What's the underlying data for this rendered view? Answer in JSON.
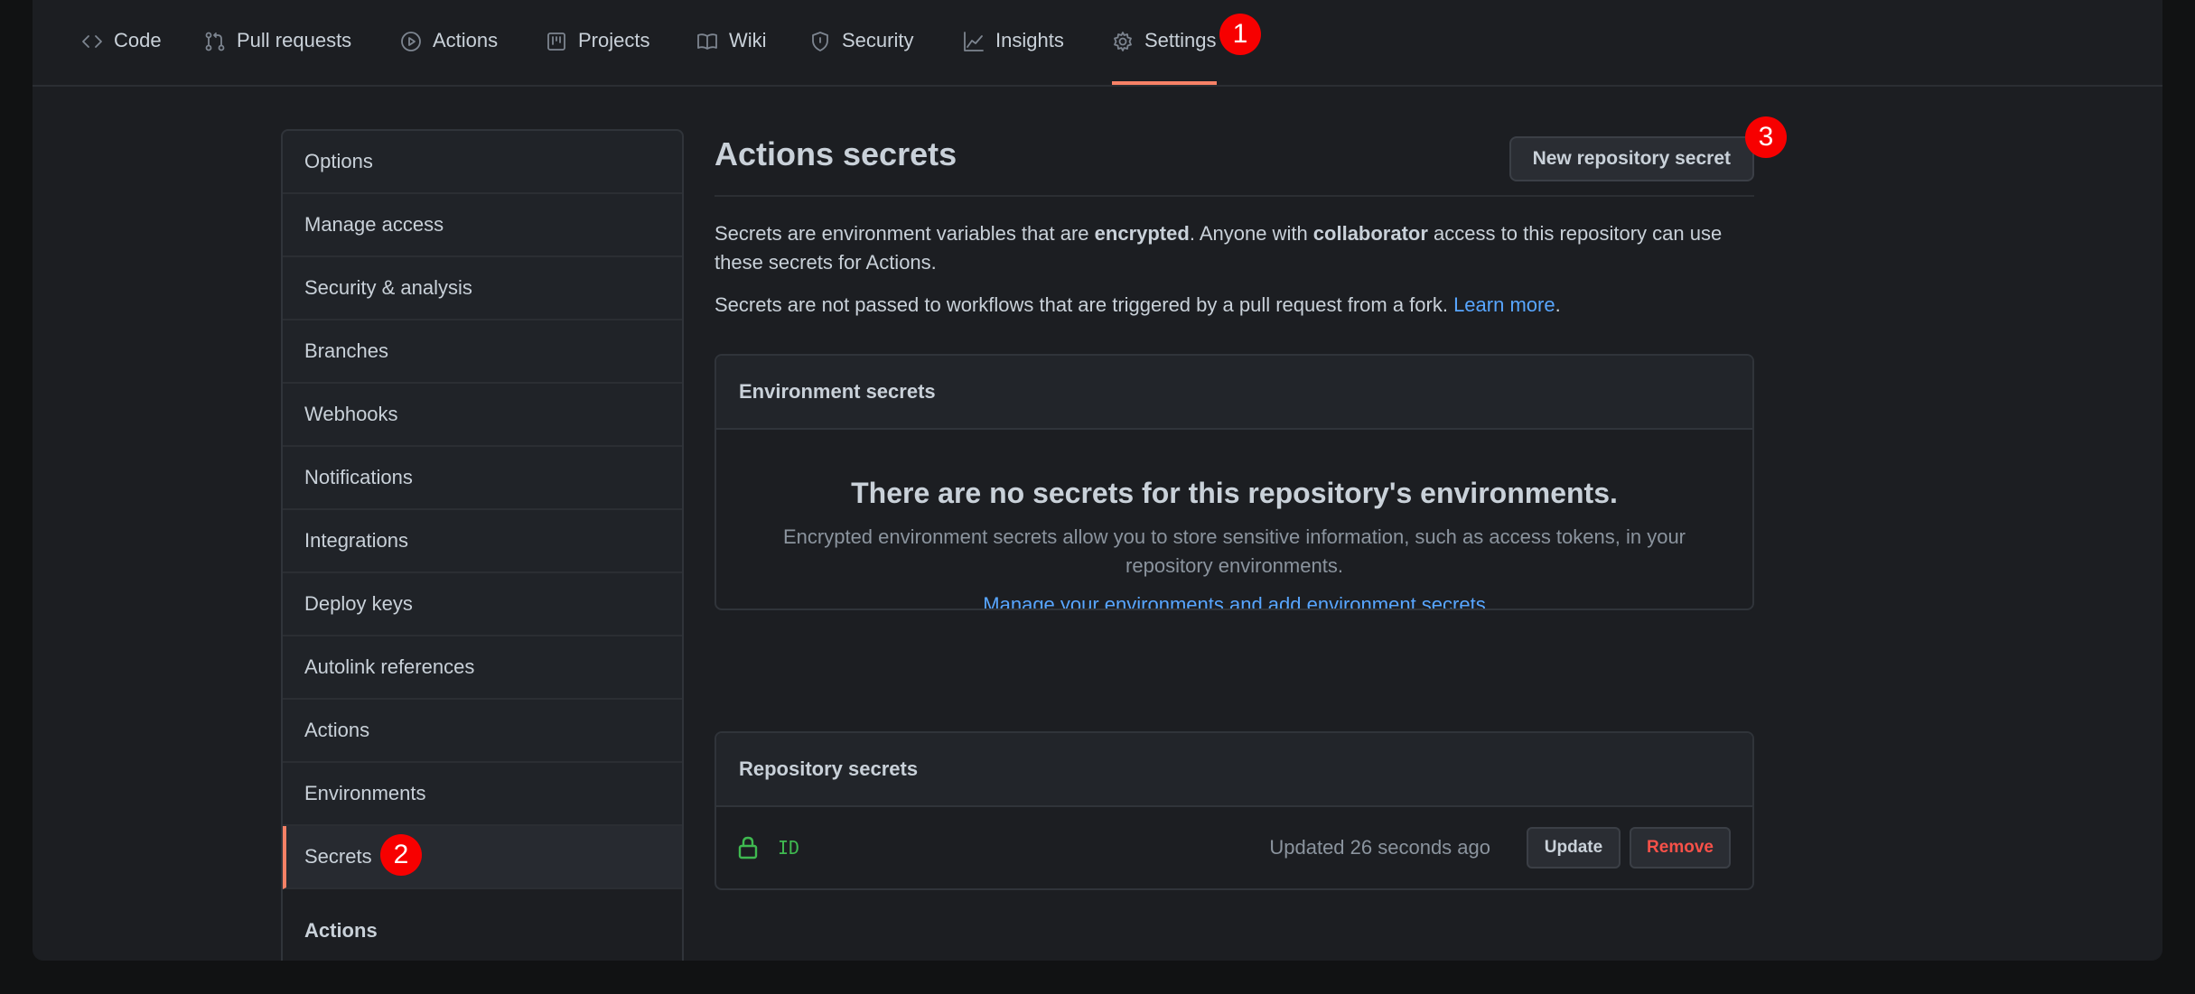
{
  "nav": {
    "tabs": [
      {
        "label": "Code",
        "icon": "code-icon"
      },
      {
        "label": "Pull requests",
        "icon": "pull-request-icon"
      },
      {
        "label": "Actions",
        "icon": "play-icon"
      },
      {
        "label": "Projects",
        "icon": "project-icon"
      },
      {
        "label": "Wiki",
        "icon": "book-icon"
      },
      {
        "label": "Security",
        "icon": "shield-icon"
      },
      {
        "label": "Insights",
        "icon": "graph-icon"
      },
      {
        "label": "Settings",
        "icon": "gear-icon"
      }
    ],
    "active_tab": "Settings",
    "active_color": "#f78166"
  },
  "badges": {
    "b1": "1",
    "b2": "2",
    "b3": "3",
    "color": "#f70000"
  },
  "sidebar": {
    "items": [
      {
        "label": "Options"
      },
      {
        "label": "Manage access"
      },
      {
        "label": "Security & analysis"
      },
      {
        "label": "Branches"
      },
      {
        "label": "Webhooks"
      },
      {
        "label": "Notifications"
      },
      {
        "label": "Integrations"
      },
      {
        "label": "Deploy keys"
      },
      {
        "label": "Autolink references"
      },
      {
        "label": "Actions"
      },
      {
        "label": "Environments"
      },
      {
        "label": "Secrets"
      }
    ],
    "selected": "Secrets",
    "section_heading": "Actions"
  },
  "main": {
    "title": "Actions secrets",
    "new_secret_button": "New repository secret",
    "desc1_a": "Secrets are environment variables that are ",
    "desc1_b": "encrypted",
    "desc1_c": ". Anyone with ",
    "desc1_d": "collaborator",
    "desc1_e": " access to this repository can use these secrets for Actions.",
    "desc2_a": "Secrets are not passed to workflows that are triggered by a pull request from a fork. ",
    "desc2_link": "Learn more",
    "desc2_end": ".",
    "env_box": {
      "header": "Environment secrets",
      "blank_title": "There are no secrets for this repository's environments.",
      "blank_text": "Encrypted environment secrets allow you to store sensitive information, such as access tokens, in your repository environments.",
      "blank_link": "Manage your environments and add environment secrets"
    },
    "repo_box": {
      "header": "Repository secrets",
      "secrets": [
        {
          "name": "ID",
          "updated": "Updated 26 seconds ago",
          "update_label": "Update",
          "remove_label": "Remove"
        }
      ]
    }
  }
}
